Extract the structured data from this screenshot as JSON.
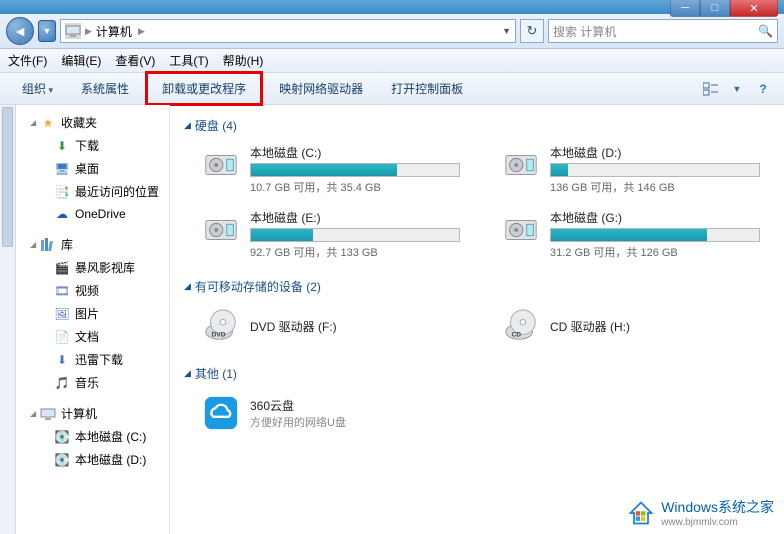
{
  "titlebar": {
    "min": "─",
    "max": "□",
    "close": "✕"
  },
  "nav": {
    "back": "◄",
    "fwd": "▼",
    "path_label": "计算机",
    "path_sep": "▶",
    "dropdown": "▼",
    "refresh": "↻",
    "search_placeholder": "搜索 计算机",
    "search_icon": "🔍"
  },
  "menubar": {
    "file": "文件(F)",
    "edit": "编辑(E)",
    "view": "查看(V)",
    "tools": "工具(T)",
    "help": "帮助(H)"
  },
  "toolbar": {
    "organize": "组织",
    "properties": "系统属性",
    "uninstall": "卸载或更改程序",
    "map_drive": "映射网络驱动器",
    "control_panel": "打开控制面板"
  },
  "sidebar": {
    "fav_label": "收藏夹",
    "fav_items": [
      {
        "icon": "⬇",
        "color": "#2a9c4a",
        "label": "下载"
      },
      {
        "icon": "🖥",
        "color": "#3a7ac0",
        "label": "桌面"
      },
      {
        "icon": "📑",
        "color": "#c88a3a",
        "label": "最近访问的位置"
      },
      {
        "icon": "☁",
        "color": "#1860b0",
        "label": "OneDrive"
      }
    ],
    "lib_label": "库",
    "lib_items": [
      {
        "icon": "🎬",
        "color": "#5070c0",
        "label": "暴风影视库"
      },
      {
        "icon": "🎞",
        "color": "#5070c0",
        "label": "视频"
      },
      {
        "icon": "🖼",
        "color": "#5070c0",
        "label": "图片"
      },
      {
        "icon": "📄",
        "color": "#5070c0",
        "label": "文档"
      },
      {
        "icon": "⬇",
        "color": "#5070c0",
        "label": "迅雷下载"
      },
      {
        "icon": "🎵",
        "color": "#5070c0",
        "label": "音乐"
      }
    ],
    "computer_label": "计算机",
    "computer_items": [
      {
        "icon": "💽",
        "label": "本地磁盘 (C:)"
      },
      {
        "icon": "💽",
        "label": "本地磁盘 (D:)"
      }
    ]
  },
  "content": {
    "hdd_header": "硬盘 (4)",
    "drives": [
      {
        "name": "本地磁盘 (C:)",
        "fill": 70,
        "stat": "10.7 GB 可用，共 35.4 GB"
      },
      {
        "name": "本地磁盘 (D:)",
        "fill": 8,
        "stat": "136 GB 可用，共 146 GB"
      },
      {
        "name": "本地磁盘 (E:)",
        "fill": 30,
        "stat": "92.7 GB 可用，共 133 GB"
      },
      {
        "name": "本地磁盘 (G:)",
        "fill": 75,
        "stat": "31.2 GB 可用，共 126 GB"
      }
    ],
    "removable_header": "有可移动存储的设备 (2)",
    "removable": [
      {
        "name": "DVD 驱动器 (F:)",
        "type": "dvd"
      },
      {
        "name": "CD 驱动器 (H:)",
        "type": "cd"
      }
    ],
    "other_header": "其他 (1)",
    "other": [
      {
        "name": "360云盘",
        "sub": "方便好用的网络U盘"
      }
    ]
  },
  "watermark": {
    "main": "Windows系统之家",
    "sub": "www.bjmmlv.com"
  }
}
